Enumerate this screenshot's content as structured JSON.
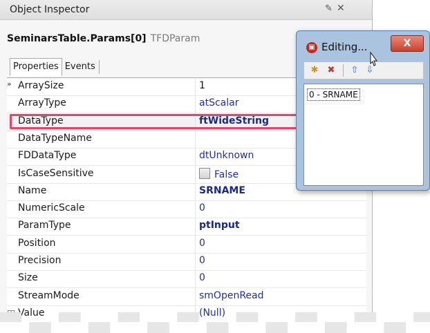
{
  "inspector": {
    "title": "Object Inspector",
    "object_name": "SeminarsTable.Params[0]",
    "object_class": "TFDParam",
    "tabs": [
      {
        "label": "Properties",
        "active": true
      },
      {
        "label": "Events",
        "active": false
      }
    ],
    "properties": [
      {
        "name": "ArraySize",
        "value": "1",
        "marker": "»"
      },
      {
        "name": "ArrayType",
        "value": "atScalar"
      },
      {
        "name": "DataType",
        "value": "ftWideString",
        "highlighted": true
      },
      {
        "name": "DataTypeName",
        "value": ""
      },
      {
        "name": "FDDataType",
        "value": "dtUnknown"
      },
      {
        "name": "IsCaseSensitive",
        "value": "False",
        "checkbox": true
      },
      {
        "name": "Name",
        "value": "SRNAME"
      },
      {
        "name": "NumericScale",
        "value": "0"
      },
      {
        "name": "ParamType",
        "value": "ptInput"
      },
      {
        "name": "Position",
        "value": "0"
      },
      {
        "name": "Precision",
        "value": "0"
      },
      {
        "name": "Size",
        "value": "0"
      },
      {
        "name": "StreamMode",
        "value": "smOpenRead"
      },
      {
        "name": "Value",
        "value": "(Null)",
        "expandable": true
      }
    ],
    "highlight_color": "#e8426f"
  },
  "dialog": {
    "title": "Editing...",
    "close_label": "X",
    "toolbar_icons": [
      "add-item-icon",
      "delete-item-icon",
      "move-up-icon",
      "move-down-icon"
    ],
    "list_items": [
      "0 - SRNAME"
    ]
  }
}
